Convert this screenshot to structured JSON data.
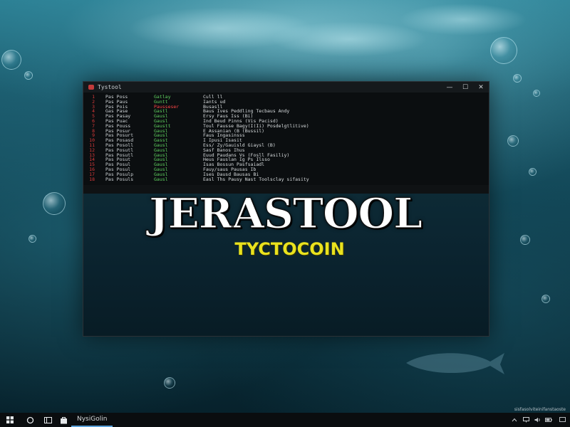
{
  "window": {
    "title": "Tystool",
    "controls": {
      "minimize": "—",
      "maximize": "☐",
      "close": "✕"
    }
  },
  "terminal": {
    "lines": [
      {
        "n": "1",
        "a": "Pas   Poss",
        "b": "Gatlay",
        "c": "Cull ll"
      },
      {
        "n": "2",
        "a": "Pas   Paus",
        "b": "Guntt",
        "c": "Iants ud"
      },
      {
        "n": "3",
        "a": "Pas   Pois",
        "b": "Pausseser",
        "c": "Busasll",
        "hl": true
      },
      {
        "n": "4",
        "a": "Gas   Pase",
        "b": "Gastl",
        "c": "Baus  Ives  Peddling  Tecbaus  Andy"
      },
      {
        "n": "5",
        "a": "Pas   Pasay",
        "b": "Gausl",
        "c": "Ersy  Faus  Iss  (Bi)"
      },
      {
        "n": "6",
        "a": "Pas   Puac",
        "b": "Gausl",
        "c": "Ind   Beud  Pinns  (Vis  Pacisd)"
      },
      {
        "n": "7",
        "a": "Pas   Pouss",
        "b": "Gaustt",
        "c": "Toul  Fausse  Bagy(I(Ii)  Posdelgtlitive)"
      },
      {
        "n": "8",
        "a": "Pas   Posur",
        "b": "Gausl",
        "c": "E  Assanian  (B  (Bussil)"
      },
      {
        "n": "9",
        "a": "Pas   Posurt",
        "b": "Gausl",
        "c": "Faus  Ingasinsss"
      },
      {
        "n": "10",
        "a": "Pas   Posasd",
        "b": "Gasst",
        "c": "I  Ipusi  Isasit"
      },
      {
        "n": "11",
        "a": "Pas   Posoll",
        "b": "Gausl",
        "c": "Ess/  Zy/Gauisld  Giaysl  (B)"
      },
      {
        "n": "12",
        "a": "Pas   Posutl",
        "b": "Gausl",
        "c": "Sasf  Banos  Ihus"
      },
      {
        "n": "13",
        "a": "Pas   Posutl",
        "b": "Gausl",
        "c": "Euud  Paudans  Vs  (Fosll  Fasiliy)"
      },
      {
        "n": "14",
        "a": "Pas   Posut",
        "b": "Gausl",
        "c": "Heus  Fauslan  Ig  Ps  Ilsso"
      },
      {
        "n": "15",
        "a": "Pas   Posul",
        "b": "Gausl",
        "c": "Isas  Bossun  Pasfsaiadl"
      },
      {
        "n": "16",
        "a": "Pas   Posul",
        "b": "Gausl",
        "c": "Fauy/saus  Pausas  Ib"
      },
      {
        "n": "17",
        "a": "Pas   Posulp",
        "b": "Gausl",
        "c": "Ises  Dausd  Bausas  Bi"
      },
      {
        "n": "18",
        "a": "Pas   Posuls",
        "b": "Gausl",
        "c": "Easl  Ths  Pausy  Nast  Toolsclay  sifasity"
      }
    ]
  },
  "logo": {
    "title": "JERASTOOL",
    "subtitle": "TYCTOCOIN"
  },
  "taskbar": {
    "app_label": "NysiGolin"
  },
  "watermark": "sisfasolviteinifanstaoste",
  "colors": {
    "accent": "#5aa0d8",
    "line_numbers": "#d93a3a",
    "green_text": "#5fd15f",
    "subtitle": "#e9e21e"
  }
}
